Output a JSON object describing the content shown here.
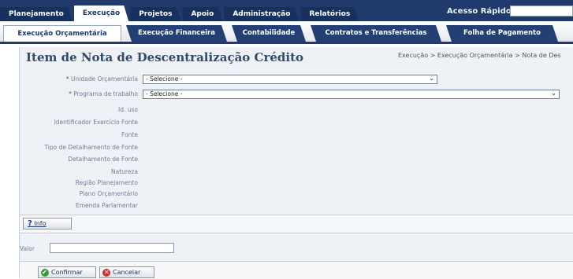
{
  "nav": {
    "main_tabs": [
      "Planejamento",
      "Execução",
      "Projetos",
      "Apoio",
      "Administração",
      "Relatórios"
    ],
    "active_main": "Execução",
    "quick_access_label": "Acesso Rápido",
    "sub_tabs": [
      "Execução Orçamentária",
      "Execução Financeira",
      "Contabilidade",
      "Contratos e Transferências",
      "Folha de Pagamento"
    ],
    "active_sub": "Execução Orçamentária"
  },
  "page": {
    "title": "Item de Nota de Descentralização Crédito",
    "breadcrumb": "Execução > Execução Orçamentária > Nota de Des"
  },
  "form": {
    "unidade_label": "Unidade Orçamentária",
    "unidade_value": "- Selecione -",
    "programa_label": "Programa de trabalho",
    "programa_value": "- Selecione -",
    "required_mark": "*",
    "fields": [
      "Id. uso",
      "Identificador Exercício Fonte",
      "Fonte",
      "Tipo de Detalhamento de Fonte",
      "Detalhamento de Fonte",
      "Natureza",
      "Região Planejamento",
      "Plano Orçamentário",
      "Emenda Parlamentar"
    ],
    "info_label": "Info",
    "info_icon": "?",
    "valor_label": "Valor",
    "confirm_label": "Confirmar",
    "cancel_label": "Cancelar"
  },
  "icons": {
    "dropdown": "chevron-down-icon",
    "confirm": "check-icon",
    "cancel": "cancel-icon",
    "info": "help-icon"
  },
  "colors": {
    "nav_bg": "#1f3a6b",
    "panel_bg": "#eef1f5",
    "title": "#334a70"
  }
}
